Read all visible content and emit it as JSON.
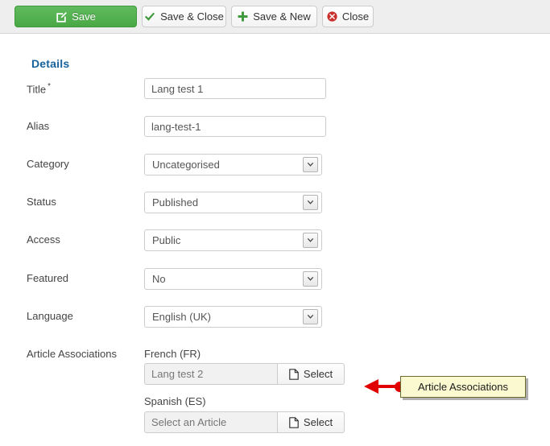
{
  "toolbar": {
    "buttons": [
      {
        "label": "Save",
        "icon": "edit-pencil-square-icon",
        "style": "primary"
      },
      {
        "label": "Save & Close",
        "icon": "check-icon",
        "style": "plain"
      },
      {
        "label": "Save & New",
        "icon": "plus-icon",
        "style": "plain"
      },
      {
        "label": "Close",
        "icon": "close-circle-icon",
        "style": "plain"
      }
    ],
    "primary_color": "#49a845",
    "check_color": "#3f9a3c",
    "plus_color": "#3f9a3c",
    "close_color": "#c9302c"
  },
  "form": {
    "heading": "Details",
    "heading_color": "#16639e",
    "fields": {
      "title": {
        "label": "Title",
        "required_marker": "*",
        "value": "Lang test 1",
        "placeholder": ""
      },
      "alias": {
        "label": "Alias",
        "value": "lang-test-1",
        "placeholder": ""
      },
      "category": {
        "label": "Category",
        "value": "Uncategorised",
        "options": [
          "Uncategorised"
        ]
      },
      "status": {
        "label": "Status",
        "value": "Published",
        "options": [
          "Published"
        ]
      },
      "access": {
        "label": "Access",
        "value": "Public",
        "options": [
          "Public"
        ]
      },
      "featured": {
        "label": "Featured",
        "value": "No",
        "options": [
          "No"
        ]
      },
      "language": {
        "label": "Language",
        "value": "English (UK)",
        "options": [
          "English (UK)"
        ]
      }
    },
    "associations": {
      "label": "Article Associations",
      "items": [
        {
          "language": "French (FR)",
          "value": "Lang test 2",
          "placeholder": "",
          "button_label": "Select",
          "button_icon": "document-icon"
        },
        {
          "language": "Spanish (ES)",
          "value": "",
          "placeholder": "Select an Article",
          "button_label": "Select",
          "button_icon": "document-icon"
        }
      ]
    }
  },
  "annotation": {
    "text": "Article Associations",
    "arrow_color": "#e00000",
    "box_fill": "#fbf9d0",
    "box_border": "#6b6b2d"
  }
}
